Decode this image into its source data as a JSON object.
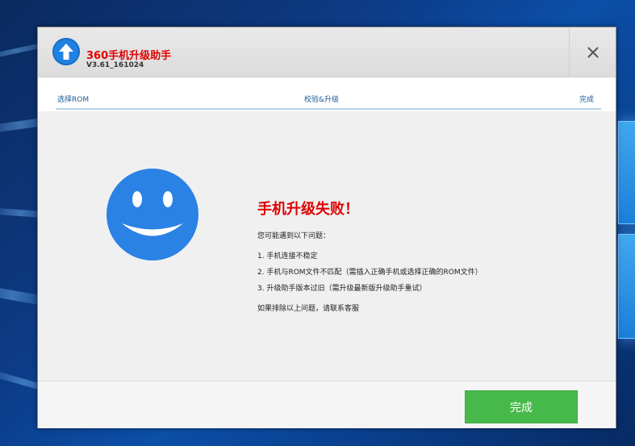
{
  "window": {
    "title": "360手机升级助手",
    "version": "V3.61_161024",
    "close_label": "×"
  },
  "steps": [
    {
      "label": "选择ROM"
    },
    {
      "label": "校验&升级"
    },
    {
      "label": "完成"
    }
  ],
  "result": {
    "title": "手机升级失败！",
    "intro": "您可能遇到以下问题：",
    "issues": [
      "1. 手机连接不稳定",
      "2. 手机与ROM文件不匹配（需插入正确手机或选择正确的ROM文件）",
      "3. 升级助手版本过旧（需升级最新版升级助手重试）"
    ],
    "outro": "如果排除以上问题，请联系客服"
  },
  "footer": {
    "finish_label": "完成"
  },
  "colors": {
    "accent_red": "#e00000",
    "logo_blue": "#1f82e3",
    "smiley_blue": "#2a82e4",
    "button_green": "#47b94a"
  },
  "icons": {
    "logo": "upload-arrow-icon",
    "close": "close-icon",
    "smiley": "smiley-face-icon"
  }
}
